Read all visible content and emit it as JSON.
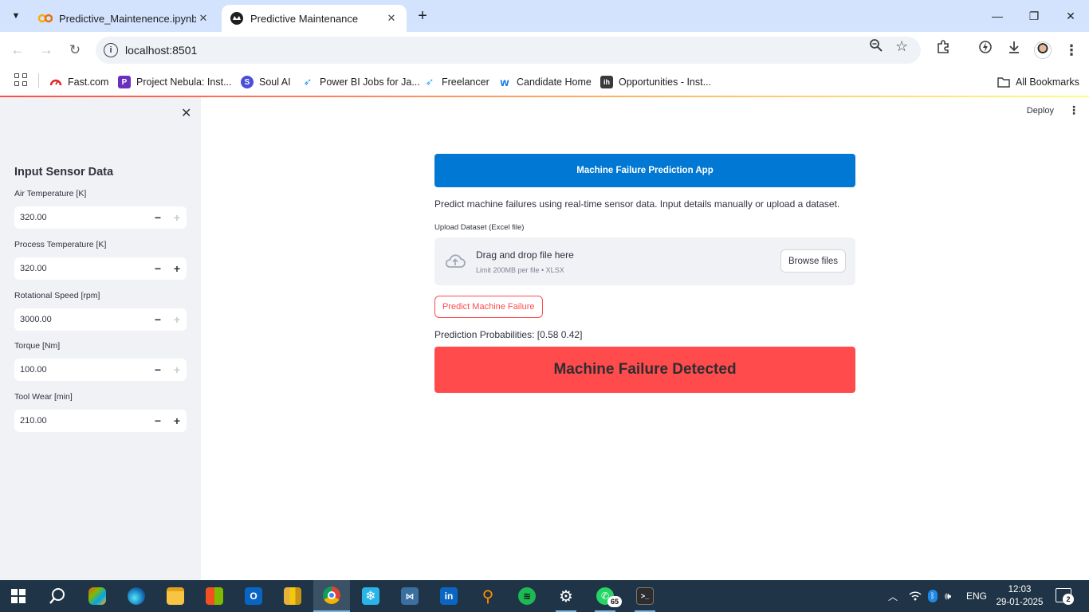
{
  "browser": {
    "tabs": [
      {
        "title": "Predictive_Maintenence.ipynb -",
        "icon": "colab-icon"
      },
      {
        "title": "Predictive Maintenance",
        "icon": "streamlit-icon"
      }
    ],
    "new_tab": "+",
    "url": "localhost:8501",
    "bookmarks": [
      {
        "label": "Fast.com",
        "icon": "fastcom-icon",
        "color": "#e3242b"
      },
      {
        "label": "Project Nebula: Inst...",
        "icon": "nebula-icon",
        "color": "#6b2fbf"
      },
      {
        "label": "Soul AI",
        "icon": "soulai-icon",
        "color": "#4a4fd8"
      },
      {
        "label": "Power BI Jobs for Ja...",
        "icon": "bird-icon",
        "color": "#2196f3"
      },
      {
        "label": "Freelancer",
        "icon": "bird-icon",
        "color": "#29b2fe"
      },
      {
        "label": "Candidate Home",
        "icon": "workday-icon",
        "color": "#f5a623"
      },
      {
        "label": "Opportunities - Inst...",
        "icon": "ih-icon",
        "color": "#3a3a3a"
      }
    ],
    "all_bookmarks": "All Bookmarks"
  },
  "app": {
    "deploy_label": "Deploy",
    "sidebar": {
      "title": "Input Sensor Data",
      "fields": [
        {
          "label": "Air Temperature [K]",
          "value": "320.00",
          "plus_enabled": false
        },
        {
          "label": "Process Temperature [K]",
          "value": "320.00",
          "plus_enabled": true
        },
        {
          "label": "Rotational Speed [rpm]",
          "value": "3000.00",
          "plus_enabled": false
        },
        {
          "label": "Torque [Nm]",
          "value": "100.00",
          "plus_enabled": false
        },
        {
          "label": "Tool Wear [min]",
          "value": "210.00",
          "plus_enabled": true
        }
      ]
    },
    "main": {
      "banner": "Machine Failure Prediction App",
      "description": "Predict machine failures using real-time sensor data. Input details manually or upload a dataset.",
      "upload_label": "Upload Dataset (Excel file)",
      "dropzone_text": "Drag and drop file here",
      "dropzone_limit": "Limit 200MB per file • XLSX",
      "browse_label": "Browse files",
      "predict_label": "Predict Machine Failure",
      "probabilities": "Prediction Probabilities: [0.58 0.42]",
      "result": "Machine Failure Detected"
    },
    "colors": {
      "accent": "#ff4b4b",
      "banner": "#0078d4",
      "sidebar": "#f0f2f6"
    }
  },
  "taskbar": {
    "badge_whatsapp": "65",
    "lang": "ENG",
    "time": "12:03",
    "date": "29-01-2025",
    "notifications": "2"
  }
}
